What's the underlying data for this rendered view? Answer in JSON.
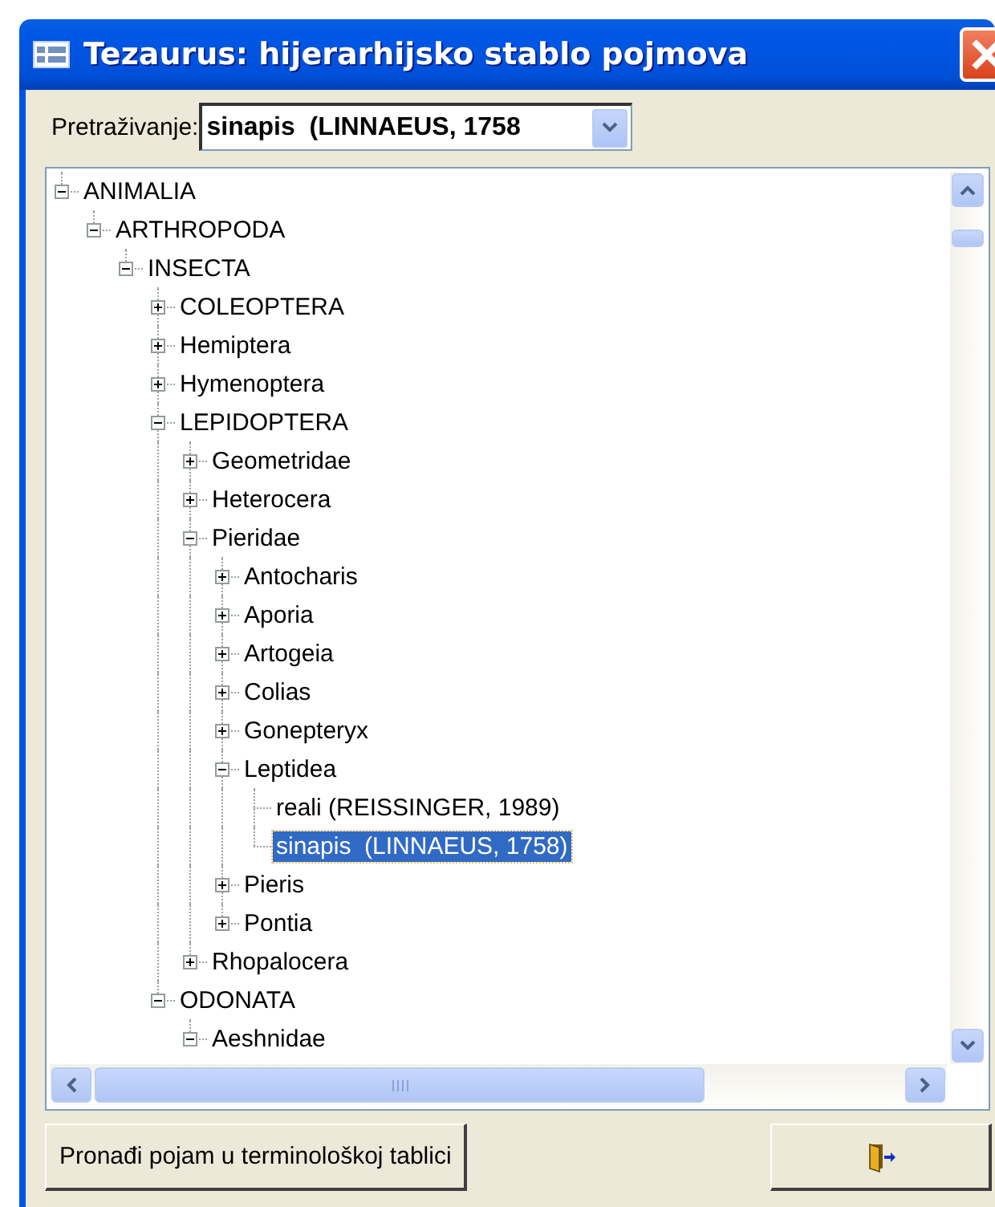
{
  "window": {
    "title": "Tezaurus: hijerarhijsko stablo pojmova"
  },
  "search": {
    "label": "Pretraživanje:",
    "value": "sinapis  (LINNAEUS, 1758"
  },
  "tree": [
    {
      "label": "ANIMALIA",
      "expanded": true,
      "selected": false,
      "children": [
        {
          "label": "ARTHROPODA",
          "expanded": true,
          "selected": false,
          "children": [
            {
              "label": "INSECTA",
              "expanded": true,
              "selected": false,
              "children": [
                {
                  "label": "COLEOPTERA",
                  "expanded": false,
                  "selected": false
                },
                {
                  "label": "Hemiptera",
                  "expanded": false,
                  "selected": false
                },
                {
                  "label": "Hymenoptera",
                  "expanded": false,
                  "selected": false
                },
                {
                  "label": "LEPIDOPTERA",
                  "expanded": true,
                  "selected": false,
                  "children": [
                    {
                      "label": "Geometridae",
                      "expanded": false,
                      "selected": false
                    },
                    {
                      "label": "Heterocera",
                      "expanded": false,
                      "selected": false
                    },
                    {
                      "label": "Pieridae",
                      "expanded": true,
                      "selected": false,
                      "children": [
                        {
                          "label": "Antocharis",
                          "expanded": false,
                          "selected": false
                        },
                        {
                          "label": "Aporia",
                          "expanded": false,
                          "selected": false
                        },
                        {
                          "label": "Artogeia",
                          "expanded": false,
                          "selected": false
                        },
                        {
                          "label": "Colias",
                          "expanded": false,
                          "selected": false
                        },
                        {
                          "label": "Gonepteryx",
                          "expanded": false,
                          "selected": false
                        },
                        {
                          "label": "Leptidea",
                          "expanded": true,
                          "selected": false,
                          "children": [
                            {
                              "label": "reali (REISSINGER, 1989)",
                              "selected": false
                            },
                            {
                              "label": "sinapis  (LINNAEUS, 1758)",
                              "selected": true
                            }
                          ]
                        },
                        {
                          "label": "Pieris",
                          "expanded": false,
                          "selected": false
                        },
                        {
                          "label": "Pontia",
                          "expanded": false,
                          "selected": false
                        }
                      ]
                    },
                    {
                      "label": "Rhopalocera",
                      "expanded": false,
                      "selected": false
                    }
                  ]
                },
                {
                  "label": "ODONATA",
                  "expanded": true,
                  "selected": false,
                  "children": [
                    {
                      "label": "Aeshnidae",
                      "expanded": true,
                      "selected": false
                    }
                  ]
                }
              ]
            }
          ]
        }
      ]
    }
  ],
  "buttons": [
    {
      "kind": "text",
      "label": "Pronađi pojam u terminološkoj tablici"
    },
    {
      "kind": "exit"
    }
  ]
}
